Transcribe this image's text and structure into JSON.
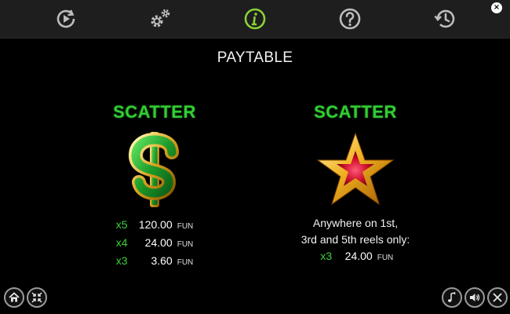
{
  "topbar": {
    "buttons": [
      {
        "name": "autoplay-icon",
        "active": false
      },
      {
        "name": "settings-icon",
        "active": false
      },
      {
        "name": "info-icon",
        "active": true
      },
      {
        "name": "help-icon",
        "active": false
      },
      {
        "name": "history-icon",
        "active": false
      }
    ],
    "close_label": "×"
  },
  "page": {
    "title": "PAYTABLE"
  },
  "paytable": {
    "left": {
      "label": "SCATTER",
      "symbol": "dollar-sign-icon",
      "rows": [
        {
          "mult": "x5",
          "amount": "120.00",
          "unit": "FUN"
        },
        {
          "mult": "x4",
          "amount": "24.00",
          "unit": "FUN"
        },
        {
          "mult": "x3",
          "amount": "3.60",
          "unit": "FUN"
        }
      ]
    },
    "right": {
      "label": "SCATTER",
      "symbol": "star-icon",
      "desc_line1": "Anywhere on 1st,",
      "desc_line2": "3rd and 5th reels only:",
      "row": {
        "mult": "x3",
        "amount": "24.00",
        "unit": "FUN"
      }
    }
  },
  "colors": {
    "accent_green": "#32cd32",
    "background": "#000000",
    "topbar": "#1e1e1e"
  }
}
